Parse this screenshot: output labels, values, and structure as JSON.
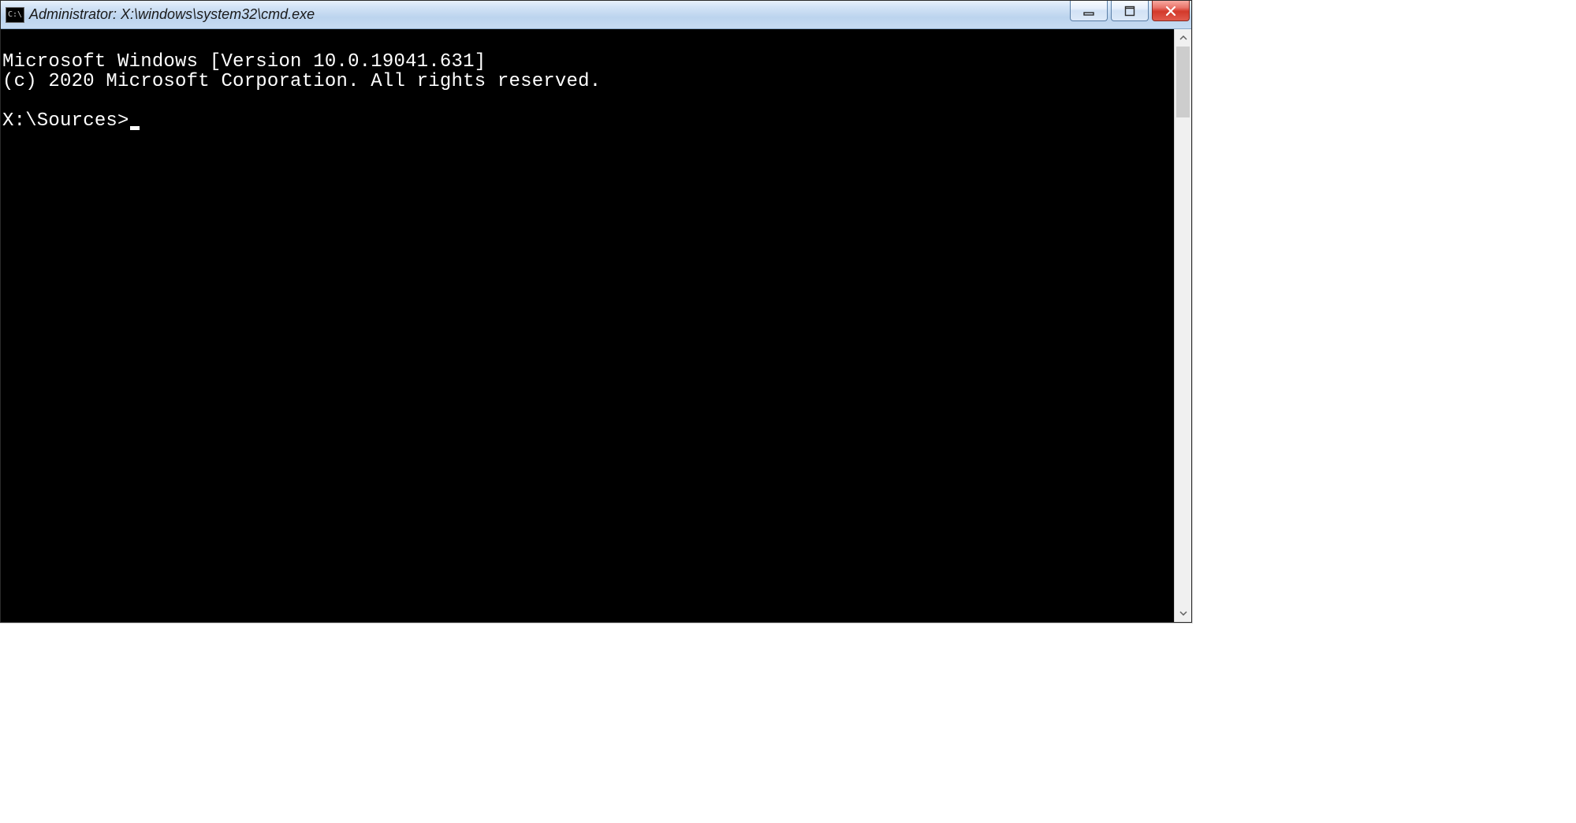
{
  "window": {
    "title": "Administrator: X:\\windows\\system32\\cmd.exe",
    "icon_label": "C:\\"
  },
  "terminal": {
    "line1": "Microsoft Windows [Version 10.0.19041.631]",
    "line2": "(c) 2020 Microsoft Corporation. All rights reserved.",
    "blank": "",
    "prompt": "X:\\Sources>"
  }
}
